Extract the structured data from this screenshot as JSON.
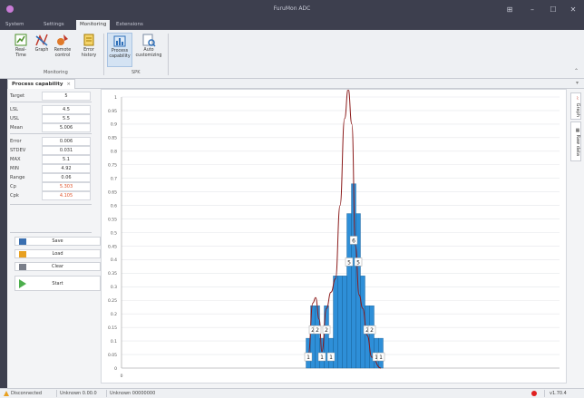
{
  "window": {
    "title": "FuruMon ADC"
  },
  "menu_tabs": [
    {
      "label": "System"
    },
    {
      "label": "Settings"
    },
    {
      "label": "Monitoring"
    },
    {
      "label": "Extensions"
    }
  ],
  "ribbon": {
    "monitoring_group": {
      "label": "Monitoring",
      "buttons": [
        {
          "label": "Real-Time",
          "icon": "realtime-icon"
        },
        {
          "label": "Graph",
          "icon": "graph-icon"
        },
        {
          "label": "Remote control",
          "icon": "remote-control-icon"
        },
        {
          "label": "Error history",
          "icon": "error-history-icon"
        }
      ]
    },
    "spc_group": {
      "label": "SPK",
      "buttons": [
        {
          "label": "Process capability",
          "icon": "process-capability-icon"
        },
        {
          "label": "Auto customizing",
          "icon": "auto-customizing-icon"
        }
      ]
    }
  },
  "doc_tab": {
    "label": "Process capability",
    "close": "×"
  },
  "stats": [
    {
      "label": "Target",
      "value": "5",
      "highlight": false
    },
    {
      "label": "LSL",
      "value": "4.5",
      "highlight": false
    },
    {
      "label": "USL",
      "value": "5.5",
      "highlight": false
    },
    {
      "label": "Mean",
      "value": "5.006",
      "highlight": false
    },
    {
      "label": "Error",
      "value": "0.006",
      "highlight": false
    },
    {
      "label": "STDEV",
      "value": "0.031",
      "highlight": false
    },
    {
      "label": "MAX",
      "value": "5.1",
      "highlight": false
    },
    {
      "label": "MIN",
      "value": "4.92",
      "highlight": false
    },
    {
      "label": "Range",
      "value": "0.06",
      "highlight": false
    },
    {
      "label": "Cp",
      "value": "5.303",
      "highlight": true
    },
    {
      "label": "Cpk",
      "value": "4.105",
      "highlight": true
    }
  ],
  "actions": {
    "save": "Save",
    "load": "Load",
    "clear": "Clear",
    "start": "Start"
  },
  "side_tabs": {
    "graph": "Graph",
    "raw_data": "Raw data"
  },
  "status": {
    "connection": "Disconnected",
    "item1": "Unknown 0.00.0",
    "item2": "Unknown 00000000",
    "version": "v1.70.4"
  },
  "colors": {
    "bar_fill": "#2e8fd8",
    "bar_stroke": "#1a5e96",
    "curve": "#8b1a1a",
    "status_red": "#e02020"
  },
  "chart_data": {
    "type": "bar",
    "y_ticks": [
      "1",
      "0.95",
      "0.9",
      "0.85",
      "0.8",
      "0.75",
      "0.7",
      "0.65",
      "0.6",
      "0.55",
      "0.5",
      "0.45",
      "0.4",
      "0.35",
      "0.3",
      "0.25",
      "0.2",
      "0.15",
      "0.1",
      "0.05",
      "0"
    ],
    "ylim": [
      0,
      1
    ],
    "grid": true,
    "bars": [
      {
        "x": 4.921,
        "value": 0.11,
        "label": "1"
      },
      {
        "x": 4.926,
        "value": 0.23,
        "label": "2"
      },
      {
        "x": 4.931,
        "value": 0.23,
        "label": "2"
      },
      {
        "x": 4.936,
        "value": 0.11,
        "label": "1"
      },
      {
        "x": 4.941,
        "value": 0.23,
        "label": "2"
      },
      {
        "x": 4.946,
        "value": 0.11,
        "label": "1"
      },
      {
        "x": 4.951,
        "value": 0.34,
        "label": "3"
      },
      {
        "x": 4.956,
        "value": 0.34,
        "label": "3"
      },
      {
        "x": 4.961,
        "value": 0.34,
        "label": "3"
      },
      {
        "x": 4.966,
        "value": 0.57,
        "label": "5"
      },
      {
        "x": 4.971,
        "value": 0.68,
        "label": "6"
      },
      {
        "x": 4.976,
        "value": 0.57,
        "label": "5"
      },
      {
        "x": 4.981,
        "value": 0.34,
        "label": "3"
      },
      {
        "x": 4.986,
        "value": 0.23,
        "label": "2"
      },
      {
        "x": 4.991,
        "value": 0.23,
        "label": "2"
      },
      {
        "x": 4.996,
        "value": 0.11,
        "label": "1"
      },
      {
        "x": 5.001,
        "value": 0.11,
        "label": "1"
      }
    ],
    "visible_labels": [
      {
        "bar": 0,
        "text": "1"
      },
      {
        "bar": 1,
        "text": "2"
      },
      {
        "bar": 2,
        "text": "2"
      },
      {
        "bar": 3,
        "text": "1"
      },
      {
        "bar": 4,
        "text": "2"
      },
      {
        "bar": 5,
        "text": "1"
      },
      {
        "bar": 9,
        "text": "5"
      },
      {
        "bar": 10,
        "text": "6"
      },
      {
        "bar": 11,
        "text": "5"
      },
      {
        "bar": 13,
        "text": "2"
      },
      {
        "bar": 14,
        "text": "2"
      },
      {
        "bar": 15,
        "text": "1"
      },
      {
        "bar": 16,
        "text": "1"
      }
    ],
    "curve": [
      [
        4.921,
        0.05
      ],
      [
        4.926,
        0.24
      ],
      [
        4.929,
        0.26
      ],
      [
        4.933,
        0.18
      ],
      [
        4.936,
        0.06
      ],
      [
        4.941,
        0.22
      ],
      [
        4.946,
        0.28
      ],
      [
        4.951,
        0.33
      ],
      [
        4.956,
        0.6
      ],
      [
        4.961,
        0.92
      ],
      [
        4.965,
        1.03
      ],
      [
        4.969,
        0.9
      ],
      [
        4.973,
        0.45
      ],
      [
        4.977,
        0.27
      ],
      [
        4.981,
        0.22
      ],
      [
        4.986,
        0.12
      ],
      [
        4.991,
        0.04
      ],
      [
        5.001,
        0.0
      ]
    ]
  }
}
